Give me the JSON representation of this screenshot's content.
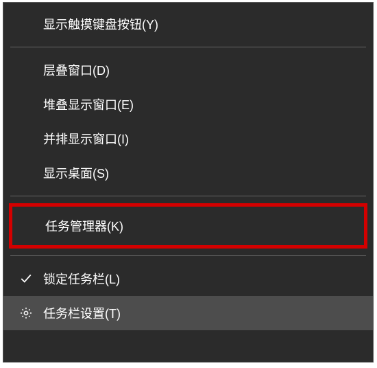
{
  "menu": {
    "show_touch_keyboard_button": "显示触摸键盘按钮(Y)",
    "cascade_windows": "层叠窗口(D)",
    "stacked_windows": "堆叠显示窗口(E)",
    "side_by_side_windows": "并排显示窗口(I)",
    "show_desktop": "显示桌面(S)",
    "task_manager": "任务管理器(K)",
    "lock_taskbar": "锁定任务栏(L)",
    "taskbar_settings": "任务栏设置(T)"
  }
}
